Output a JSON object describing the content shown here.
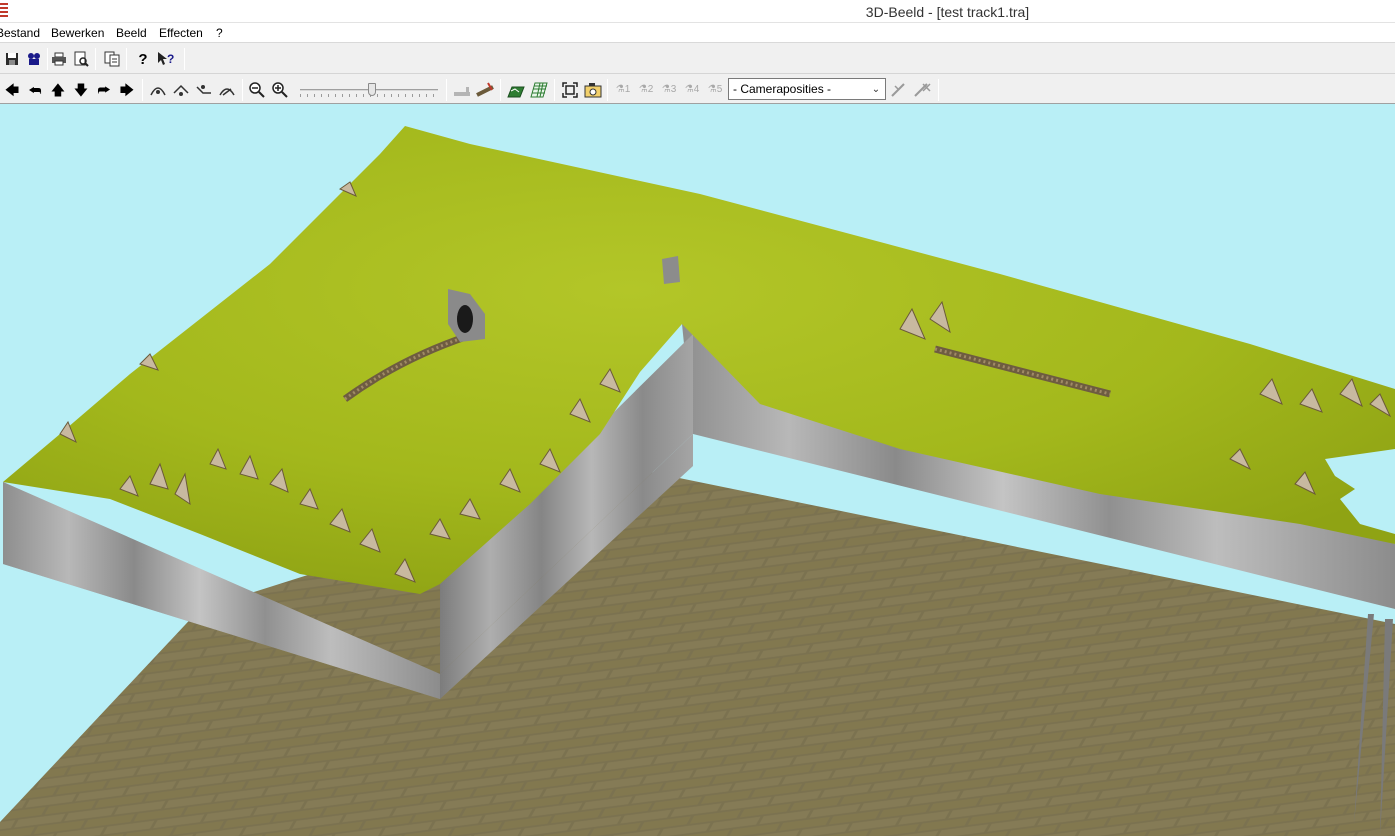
{
  "window": {
    "title": "3D-Beeld - [test track1.tra]"
  },
  "menu": {
    "items": [
      "Bestand",
      "Bewerken",
      "Beeld",
      "Effecten",
      "?"
    ]
  },
  "toolbar1": {
    "icons": [
      "save-icon",
      "camera-icon",
      "print-icon",
      "print-preview-icon",
      "copy-icon",
      "help-icon",
      "context-help-icon"
    ]
  },
  "toolbar2": {
    "camera_select": {
      "selected": "- Cameraposities -"
    },
    "camera_buttons": [
      "1",
      "2",
      "3",
      "4",
      "5"
    ],
    "zoom_slider_value": 0.5
  },
  "colors": {
    "sky": "#b9eff6",
    "grass": "#a9bd1c",
    "cliff": "#9a9a9a",
    "floor": "#7a7048"
  }
}
